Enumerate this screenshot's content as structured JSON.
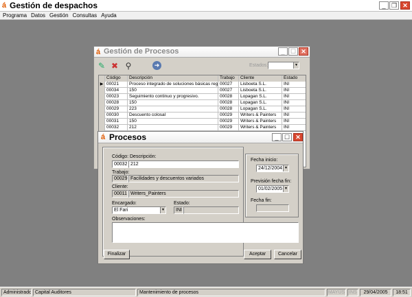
{
  "app": {
    "title": "Gestión de despachos"
  },
  "menu": [
    "Programa",
    "Datos",
    "Gestión",
    "Consultas",
    "Ayuda"
  ],
  "statusbar": {
    "user": "Administrador",
    "company": "Capital Auditores",
    "module": "Mantenimiento de procesos",
    "caps": "MAYÚS",
    "ins": "INS",
    "date": "29/04/2005",
    "time": "18:51"
  },
  "procesos_window": {
    "title": "Gestión de Procesos",
    "estados_label": "Estados:",
    "columns": [
      "Código",
      "Descripción",
      "Trabajo",
      "Cliente",
      "Estado"
    ],
    "rows": [
      [
        "00021",
        "Proceso integrado de soluciones básicas reglar",
        "00027",
        "Lisboeta S.L.",
        "INI"
      ],
      [
        "00034",
        "150",
        "00027",
        "Lisboeta S.L.",
        "INI"
      ],
      [
        "00023",
        "Seguimiento continuo y progresivo.",
        "00028",
        "Lopagan S.L.",
        "INI"
      ],
      [
        "00028",
        "150",
        "00028",
        "Lopagan S.L.",
        "INI"
      ],
      [
        "00029",
        "223",
        "00028",
        "Lopagan S.L.",
        "INI"
      ],
      [
        "00030",
        "Descuento colosal",
        "00029",
        "Writers & Painters",
        "INI"
      ],
      [
        "00031",
        "150",
        "00029",
        "Writers & Painters",
        "INI"
      ],
      [
        "00032",
        "212",
        "00029",
        "Writers & Painters",
        "INI"
      ]
    ]
  },
  "proceso_dialog": {
    "title": "Procesos",
    "codigo_label": "Código:",
    "descripcion_label": "Descripción:",
    "codigo": "00032",
    "descripcion": "212",
    "trabajo_label": "Trabajo:",
    "trabajo_code": "00029",
    "trabajo_desc": "Facilidades y descuentos variados",
    "cliente_label": "Cliente:",
    "cliente_code": "00011",
    "cliente_name": "Writers_Painters",
    "encargado_label": "Encargado:",
    "encargado": "El Fari",
    "estado_label": "Estado:",
    "estado": "INI",
    "observaciones_label": "Observaciones:",
    "fecha_inicio_label": "Fecha inicio:",
    "fecha_inicio": "24/12/2004",
    "prevision_label": "Previsión fecha fin:",
    "prevision": "01/02/2005",
    "fecha_fin_label": "Fecha fin:",
    "finalizar": "Finalizar",
    "aceptar": "Aceptar",
    "cancelar": "Cancelar"
  }
}
